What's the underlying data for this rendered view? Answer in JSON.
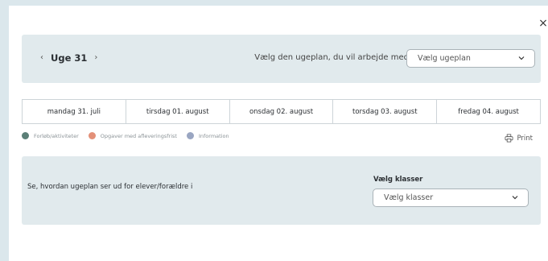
{
  "close_glyph": "×",
  "week": {
    "prev_glyph": "‹",
    "label": "Uge 31",
    "next_glyph": "›"
  },
  "plan": {
    "label": "Vælg den ugeplan, du vil arbejde med",
    "select_value": "Vælg ugeplan"
  },
  "days": [
    "mandag 31. juli",
    "tirsdag 01. august",
    "onsdag 02. august",
    "torsdag 03. august",
    "fredag 04. august"
  ],
  "legend": [
    {
      "label": "Forløb/aktiviteter",
      "color": "#5b7f77"
    },
    {
      "label": "Opgaver med afleveringsfrist",
      "color": "#e39078"
    },
    {
      "label": "Information",
      "color": "#9aa6c2"
    }
  ],
  "print_label": "Print",
  "preview": {
    "text": "Se, hvordan ugeplan ser ud for elever/forældre i",
    "class_label": "Vælg klasser",
    "select_value": "Vælg klasser"
  }
}
